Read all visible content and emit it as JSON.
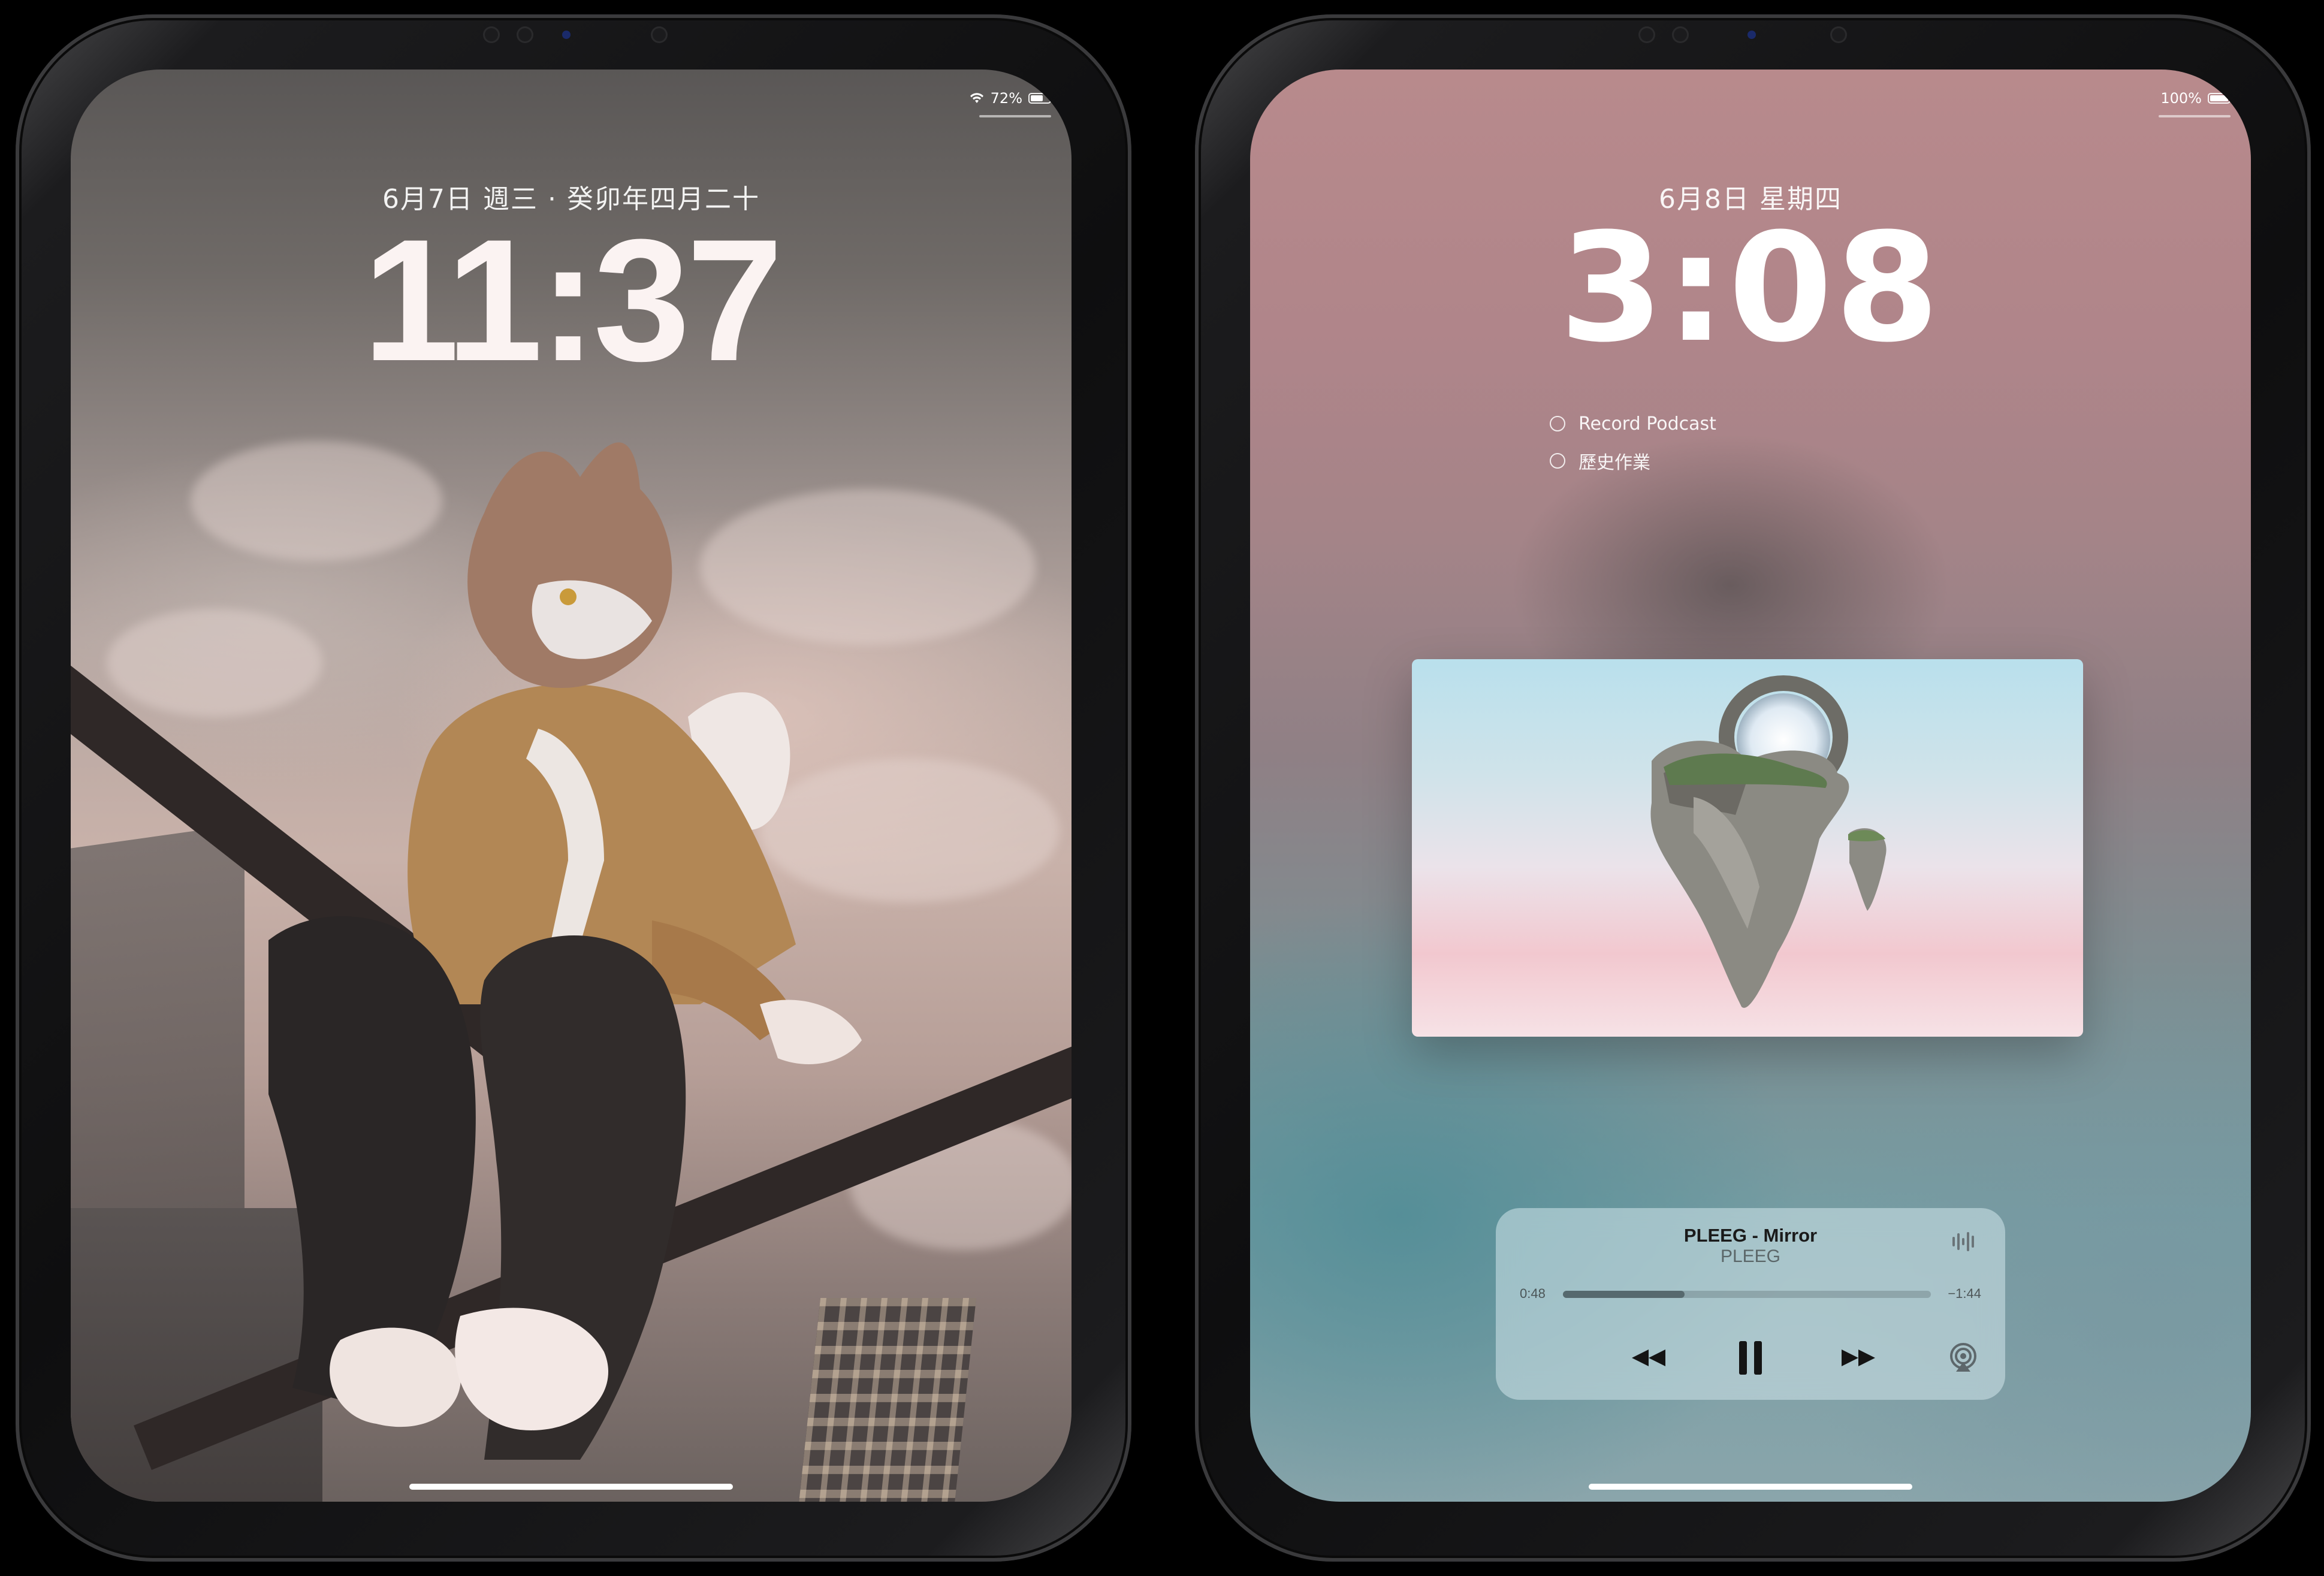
{
  "left_ipad": {
    "status": {
      "battery_percent": "72%",
      "battery_level": 0.72,
      "wifi_icon": "wifi-icon"
    },
    "date": "6月7日 週三 · 癸卯年四月二十",
    "time": "11:37"
  },
  "right_ipad": {
    "status": {
      "battery_percent": "100%",
      "battery_level": 1.0
    },
    "date": "6月8日 星期四",
    "time": "3:08",
    "reminders": [
      {
        "label": "Record Podcast"
      },
      {
        "label": "歷史作業"
      }
    ],
    "now_playing": {
      "title": "PLEEG - Mirror",
      "artist": "PLEEG",
      "elapsed": "0:48",
      "remaining": "−1:44",
      "progress": 0.33,
      "buttons": {
        "rewind_icon": "rewind-icon",
        "pause_icon": "pause-icon",
        "forward_icon": "fast-forward-icon",
        "airplay_icon": "airplay-icon",
        "waveform_icon": "waveform-icon"
      }
    }
  },
  "colors": {
    "accent": "#ffffff",
    "left_wallpaper_top": "#5a5756",
    "right_wallpaper_top": "#b88a8c",
    "right_wallpaper_bottom": "#769da3"
  }
}
